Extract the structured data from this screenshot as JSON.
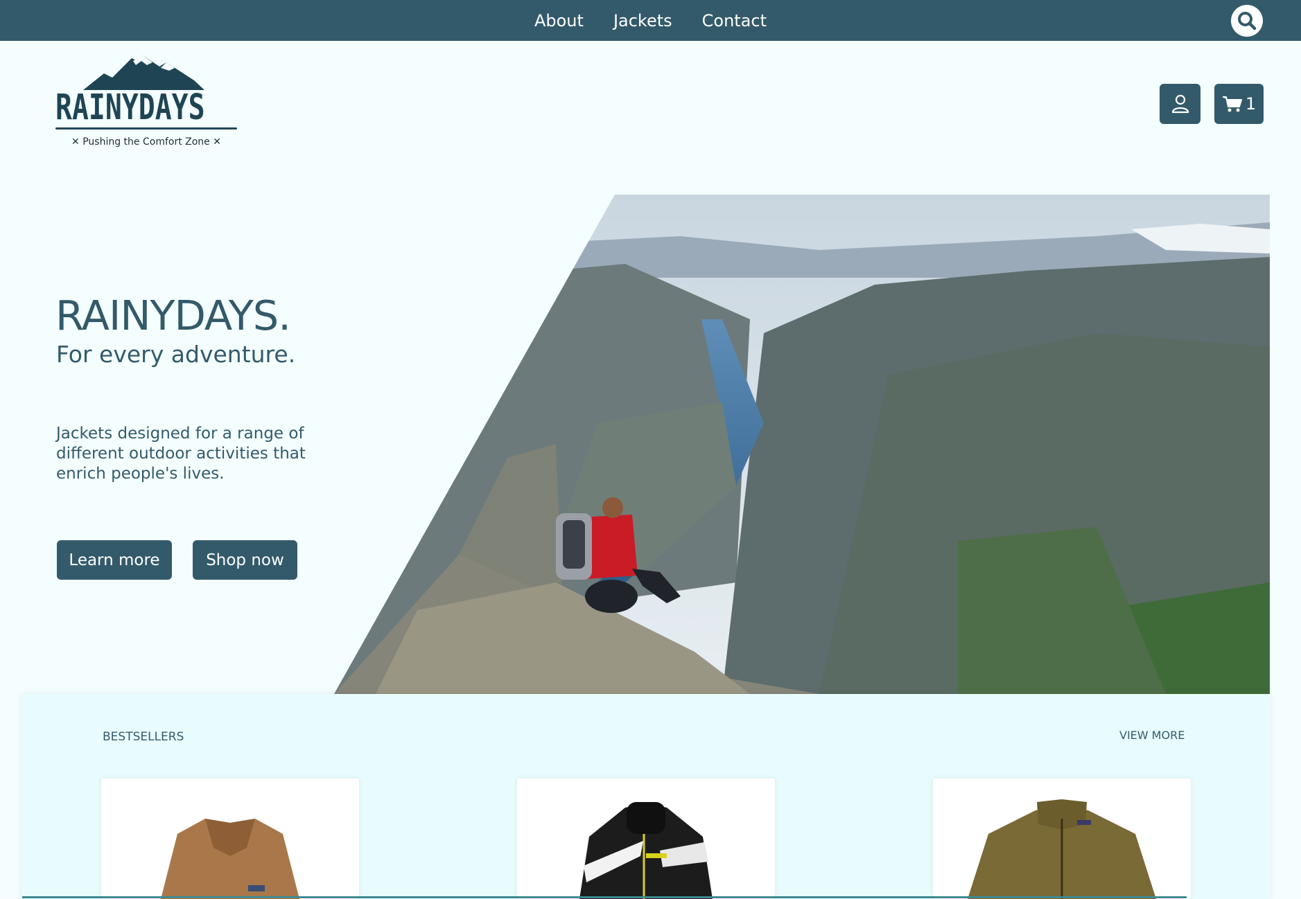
{
  "nav": {
    "links": [
      "About",
      "Jackets",
      "Contact"
    ],
    "search_icon": "search-icon"
  },
  "logo": {
    "wordmark": "RAINYDAYS",
    "tagline": "✕ Pushing the Comfort Zone ✕"
  },
  "header": {
    "account_icon": "user-icon",
    "cart_icon": "cart-icon",
    "cart_count": "1"
  },
  "hero": {
    "title": "RAINYDAYS.",
    "subtitle": "For every adventure.",
    "text": "Jackets designed for a range of different outdoor activities that enrich people's lives.",
    "learn_more": "Learn more",
    "shop_now": "Shop now",
    "image": "hiker-on-cliff-above-fjord"
  },
  "bestsellers": {
    "label": "BESTSELLERS",
    "view_more": "VIEW MORE",
    "products": [
      {
        "image": "brown-fleece-jacket"
      },
      {
        "image": "black-white-ski-jacket"
      },
      {
        "image": "olive-fleece-jacket"
      }
    ]
  },
  "colors": {
    "primary": "#335a6a",
    "background": "#f4fefe",
    "section": "#e8fcfd"
  }
}
